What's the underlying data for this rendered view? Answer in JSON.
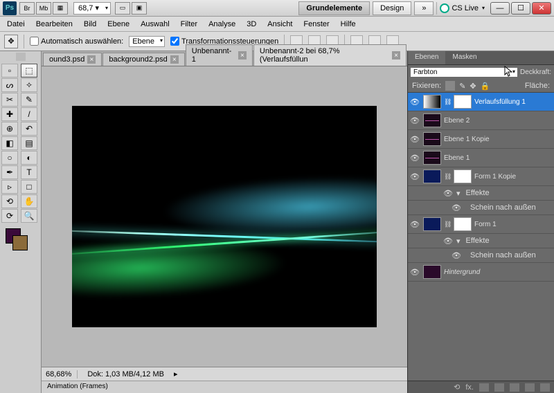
{
  "titlebar": {
    "mini_btns": [
      "Br",
      "Mb"
    ],
    "zoom": "68,7",
    "workspaces": {
      "active": "Grundelemente",
      "other": "Design",
      "more": "»"
    },
    "cslive": "CS Live"
  },
  "menus": [
    "Datei",
    "Bearbeiten",
    "Bild",
    "Ebene",
    "Auswahl",
    "Filter",
    "Analyse",
    "3D",
    "Ansicht",
    "Fenster",
    "Hilfe"
  ],
  "options": {
    "auto_select_label": "Automatisch auswählen:",
    "auto_select_value": "Ebene",
    "transform_label": "Transformationssteuerungen"
  },
  "doctabs": [
    {
      "label": "ound3.psd"
    },
    {
      "label": "background2.psd"
    },
    {
      "label": "Unbenannt-1"
    },
    {
      "label": "Unbenannt-2 bei 68,7% (Verlaufsfüllun",
      "active": true
    }
  ],
  "status": {
    "zoom": "68,68%",
    "doc": "Dok: 1,03 MB/4,12 MB"
  },
  "animation_panel": "Animation (Frames)",
  "panel": {
    "tabs": {
      "layers": "Ebenen",
      "masks": "Masken"
    },
    "blend_mode": "Farbton",
    "opacity_label": "Deckkraft:",
    "lock_label": "Fixieren:",
    "fill_label": "Fläche:"
  },
  "layers": [
    {
      "name": "Verlaufsfüllung 1",
      "selected": true,
      "thumb": "grad",
      "mask": true
    },
    {
      "name": "Ebene 2",
      "thumb": "wave-t"
    },
    {
      "name": "Ebene 1 Kopie",
      "thumb": "wave-t"
    },
    {
      "name": "Ebene 1",
      "thumb": "wave-t"
    },
    {
      "name": "Form 1 Kopie",
      "thumb": "blue",
      "mask": true,
      "fx": [
        "Effekte",
        "Schein nach außen"
      ]
    },
    {
      "name": "Form 1",
      "thumb": "blue",
      "mask": true,
      "fx": [
        "Effekte",
        "Schein nach außen"
      ]
    },
    {
      "name": "Hintergrund",
      "thumb": "dark",
      "italic": true
    }
  ],
  "tools": [
    [
      "move",
      "▫"
    ],
    [
      "marquee",
      "⬚"
    ],
    [
      "lasso",
      "ᔕ"
    ],
    [
      "wand",
      "✧"
    ],
    [
      "crop",
      "✂"
    ],
    [
      "eyedrop",
      "✎"
    ],
    [
      "heal",
      "✚"
    ],
    [
      "brush",
      "/"
    ],
    [
      "stamp",
      "⊕"
    ],
    [
      "history",
      "↶"
    ],
    [
      "eraser",
      "◧"
    ],
    [
      "gradient",
      "▤"
    ],
    [
      "blur",
      "○"
    ],
    [
      "dodge",
      "◐"
    ],
    [
      "pen",
      "✒"
    ],
    [
      "type",
      "T"
    ],
    [
      "path",
      "▹"
    ],
    [
      "shape",
      "□"
    ],
    [
      "3d",
      "⟲"
    ],
    [
      "hand",
      "✋"
    ],
    [
      "rotate",
      "⟳"
    ],
    [
      "zoom",
      "🔍"
    ]
  ],
  "colors": {
    "fg": "#3a0a3a",
    "bg": "#8b6b3a"
  }
}
